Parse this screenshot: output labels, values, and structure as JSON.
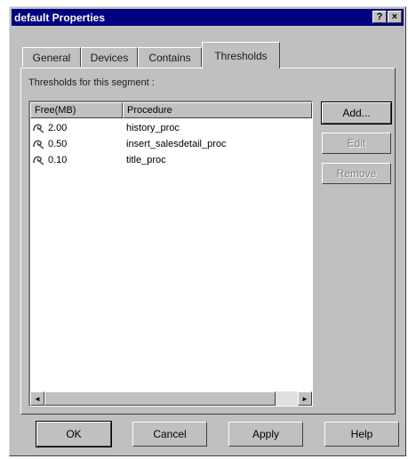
{
  "window": {
    "title": "default Properties",
    "help_glyph": "?",
    "close_glyph": "×"
  },
  "tabs": [
    {
      "label": "General",
      "active": false
    },
    {
      "label": "Devices",
      "active": false
    },
    {
      "label": "Contains",
      "active": false
    },
    {
      "label": "Thresholds",
      "active": true
    }
  ],
  "panel": {
    "segment_label": "Thresholds for this segment :",
    "columns": [
      "Free(MB)",
      "Procedure"
    ],
    "rows": [
      {
        "free": "2.00",
        "procedure": "history_proc",
        "icon": "trigger-icon"
      },
      {
        "free": "0.50",
        "procedure": "insert_salesdetail_proc",
        "icon": "trigger-icon"
      },
      {
        "free": "0.10",
        "procedure": "title_proc",
        "icon": "trigger-icon"
      }
    ],
    "scroll_left_glyph": "◄",
    "scroll_right_glyph": "►"
  },
  "side_buttons": {
    "add": "Add...",
    "edit": "Edit",
    "remove": "Remove"
  },
  "footer": {
    "ok": "OK",
    "cancel": "Cancel",
    "apply": "Apply",
    "help": "Help"
  }
}
